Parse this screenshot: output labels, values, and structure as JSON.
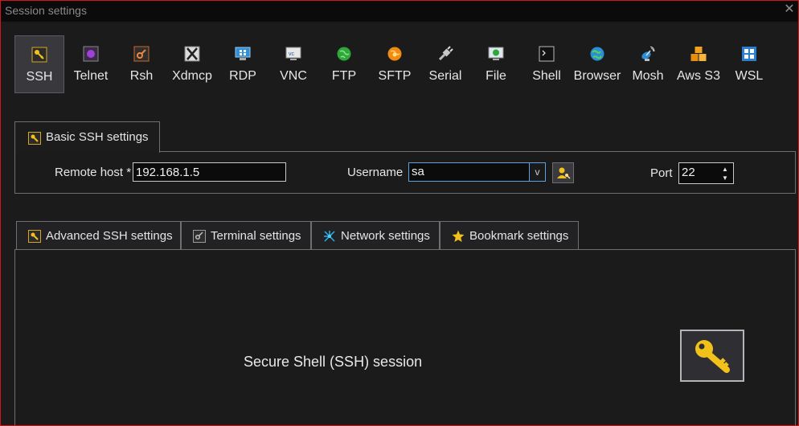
{
  "window": {
    "title": "Session settings",
    "close_glyph": "✕"
  },
  "session_types": [
    {
      "key": "ssh",
      "label": "SSH",
      "icon": "key-icon",
      "active": true
    },
    {
      "key": "telnet",
      "label": "Telnet",
      "icon": "telnet-icon"
    },
    {
      "key": "rsh",
      "label": "Rsh",
      "icon": "rsh-icon"
    },
    {
      "key": "xdmcp",
      "label": "Xdmcp",
      "icon": "x-icon"
    },
    {
      "key": "rdp",
      "label": "RDP",
      "icon": "rdp-monitor-icon"
    },
    {
      "key": "vnc",
      "label": "VNC",
      "icon": "vnc-icon"
    },
    {
      "key": "ftp",
      "label": "FTP",
      "icon": "ftp-globe-icon"
    },
    {
      "key": "sftp",
      "label": "SFTP",
      "icon": "sftp-icon"
    },
    {
      "key": "serial",
      "label": "Serial",
      "icon": "serial-plug-icon"
    },
    {
      "key": "file",
      "label": "File",
      "icon": "file-monitor-icon"
    },
    {
      "key": "shell",
      "label": "Shell",
      "icon": "shell-icon"
    },
    {
      "key": "browser",
      "label": "Browser",
      "icon": "browser-globe-icon"
    },
    {
      "key": "mosh",
      "label": "Mosh",
      "icon": "mosh-satellite-icon"
    },
    {
      "key": "awss3",
      "label": "Aws S3",
      "icon": "aws-cubes-icon"
    },
    {
      "key": "wsl",
      "label": "WSL",
      "icon": "windows-logo-icon"
    }
  ],
  "basic": {
    "tab_label": "Basic SSH settings",
    "remote_host_label": "Remote host *",
    "remote_host_value": "192.168.1.5",
    "username_label": "Username",
    "username_value": "sa",
    "username_dropdown_glyph": "v",
    "port_label": "Port",
    "port_value": "22"
  },
  "lower_tabs": [
    {
      "label": "Advanced SSH settings",
      "icon": "key-icon"
    },
    {
      "label": "Terminal settings",
      "icon": "terminal-icon"
    },
    {
      "label": "Network settings",
      "icon": "network-icon"
    },
    {
      "label": "Bookmark settings",
      "icon": "star-icon"
    }
  ],
  "description": "Secure Shell (SSH) session",
  "colors": {
    "accent_border": "#5ba3e0",
    "window_border": "#d41616",
    "key_yellow": "#f2c21b"
  }
}
